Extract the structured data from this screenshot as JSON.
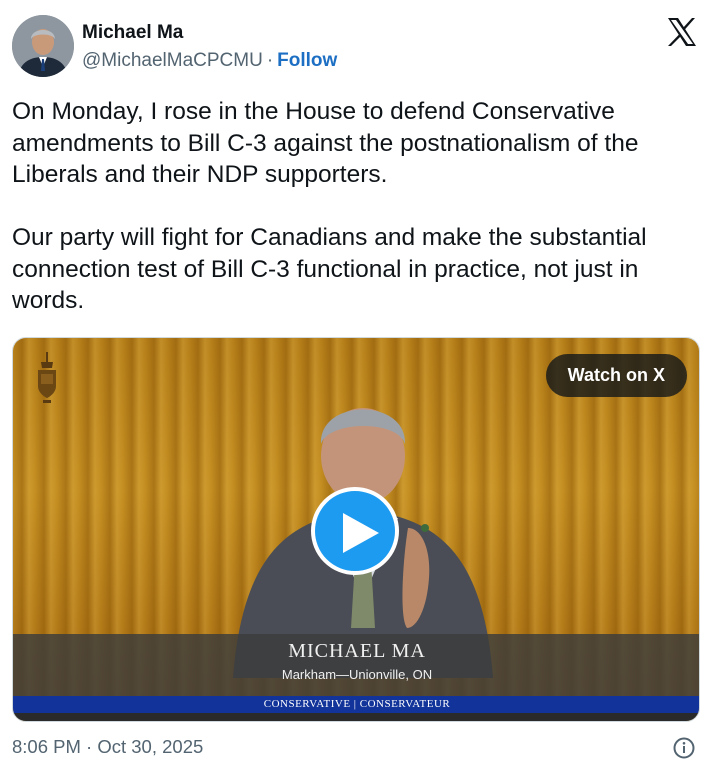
{
  "author": {
    "display_name": "Michael Ma",
    "handle": "@MichaelMaCPCMU",
    "separator": "·",
    "follow_label": "Follow",
    "avatar_icon": "user-avatar"
  },
  "header": {
    "logo_icon": "x-logo-icon"
  },
  "tweet": {
    "paragraphs": [
      "On Monday, I rose in the House to defend Conservative amendments to Bill C-3 against the postnationalism of the Liberals and their NDP supporters.",
      "Our party will fight for Canadians and make the substantial connection test of Bill C-3 functional in practice, not just in words."
    ]
  },
  "media": {
    "watch_label": "Watch on X",
    "play_icon": "play-icon",
    "lower_third": {
      "name": "MICHAEL MA",
      "riding": "Markham—Unionville, ON"
    },
    "party": "CONSERVATIVE | CONSERVATEUR"
  },
  "footer": {
    "timestamp": "8:06 PM · Oct 30, 2025",
    "info_icon": "info-icon"
  },
  "colors": {
    "link_blue": "#1d6fc4",
    "play_blue": "#1d9bf0",
    "secondary_text": "#536471",
    "party_blue": "#12339a"
  }
}
